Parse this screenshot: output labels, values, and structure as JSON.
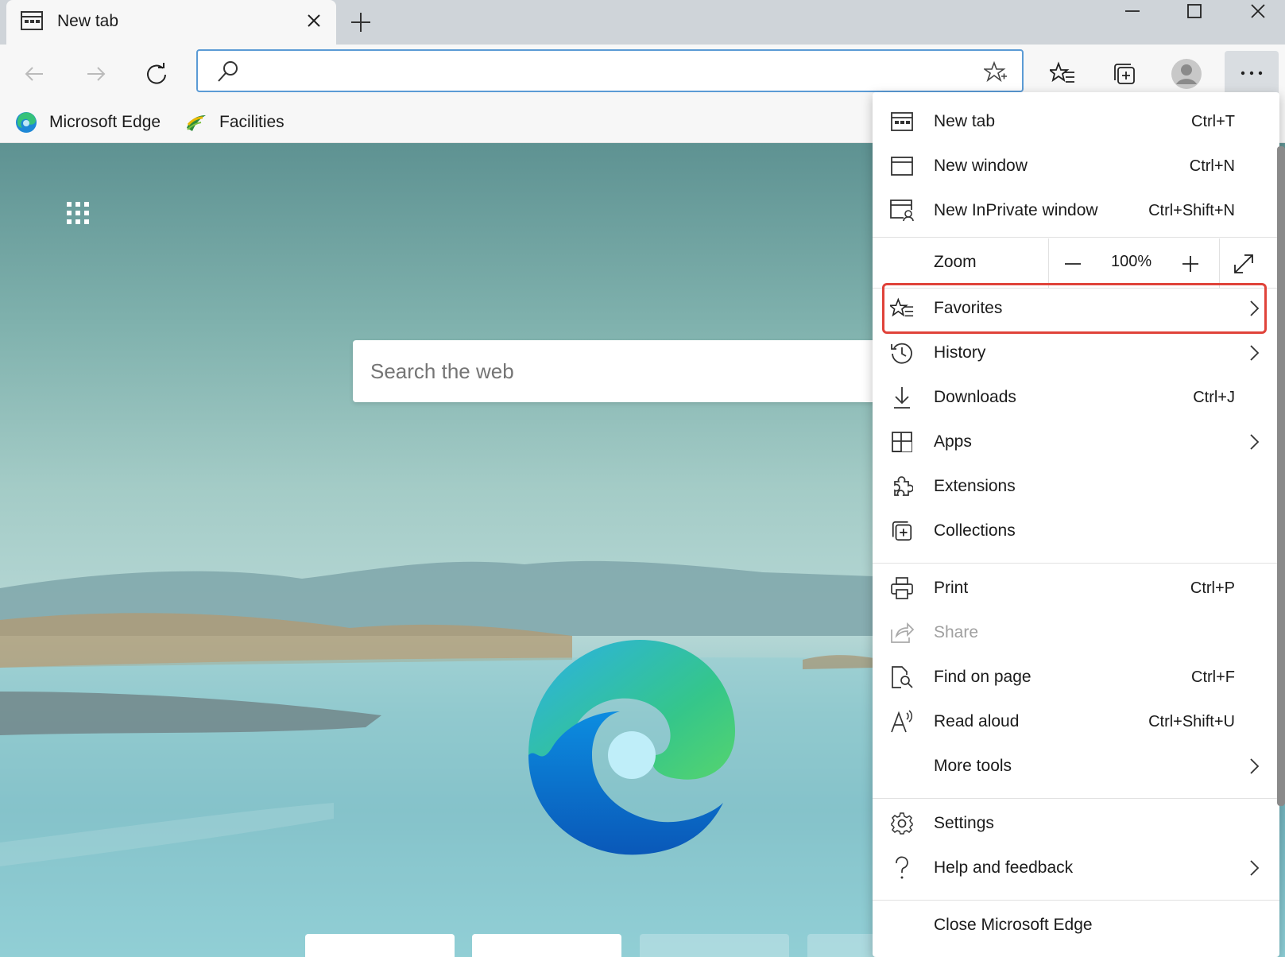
{
  "tab": {
    "title": "New tab"
  },
  "address_bar": {
    "value": "",
    "placeholder": ""
  },
  "favorites_bar": {
    "items": [
      {
        "label": "Microsoft Edge"
      },
      {
        "label": "Facilities"
      }
    ]
  },
  "page": {
    "search_placeholder": "Search the web"
  },
  "menu": {
    "new_tab": {
      "label": "New tab",
      "shortcut": "Ctrl+T"
    },
    "new_window": {
      "label": "New window",
      "shortcut": "Ctrl+N"
    },
    "new_inprivate": {
      "label": "New InPrivate window",
      "shortcut": "Ctrl+Shift+N"
    },
    "zoom": {
      "label": "Zoom",
      "value": "100%"
    },
    "favorites": {
      "label": "Favorites"
    },
    "history": {
      "label": "History"
    },
    "downloads": {
      "label": "Downloads",
      "shortcut": "Ctrl+J"
    },
    "apps": {
      "label": "Apps"
    },
    "extensions": {
      "label": "Extensions"
    },
    "collections": {
      "label": "Collections"
    },
    "print": {
      "label": "Print",
      "shortcut": "Ctrl+P"
    },
    "share": {
      "label": "Share"
    },
    "find_on_page": {
      "label": "Find on page",
      "shortcut": "Ctrl+F"
    },
    "read_aloud": {
      "label": "Read aloud",
      "shortcut": "Ctrl+Shift+U"
    },
    "more_tools": {
      "label": "More tools"
    },
    "settings": {
      "label": "Settings"
    },
    "help": {
      "label": "Help and feedback"
    },
    "close_edge": {
      "label": "Close Microsoft Edge"
    }
  },
  "colors": {
    "highlight": "#e0433a",
    "address_focus": "#5b9bd5",
    "tabstrip": "#cfd4d9"
  },
  "icons": [
    "tab-page-icon",
    "close-icon",
    "plus-icon",
    "minimize-icon",
    "maximize-icon",
    "back-icon",
    "forward-icon",
    "refresh-icon",
    "search-icon",
    "star-add-icon",
    "favorites-icon",
    "collections-icon",
    "profile-icon",
    "more-icon",
    "edge-logo-icon",
    "facilities-icon",
    "apps-grid-icon"
  ]
}
